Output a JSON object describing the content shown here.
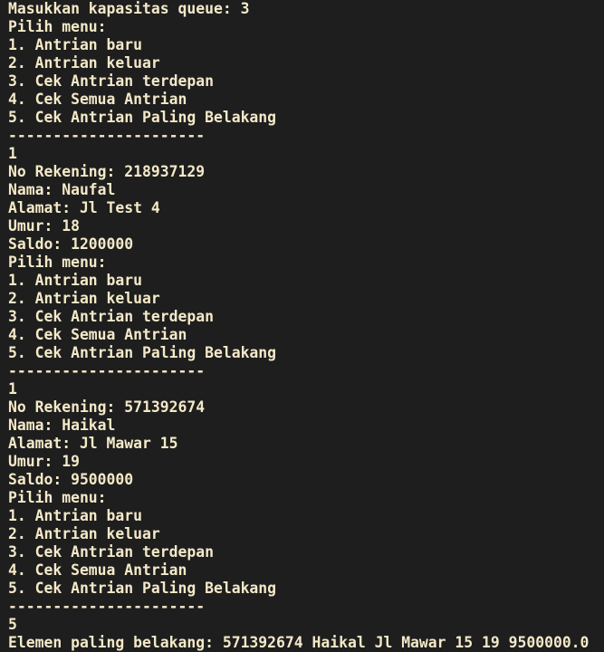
{
  "colors": {
    "background": "#1e1e1e",
    "text": "#f4e9c8"
  },
  "terminal": {
    "lines": [
      "Masukkan kapasitas queue: 3",
      "Pilih menu:",
      "1. Antrian baru",
      "2. Antrian keluar",
      "3. Cek Antrian terdepan",
      "4. Cek Semua Antrian",
      "5. Cek Antrian Paling Belakang",
      "----------------------",
      "1",
      "No Rekening: 218937129",
      "Nama: Naufal",
      "Alamat: Jl Test 4",
      "Umur: 18",
      "Saldo: 1200000",
      "Pilih menu:",
      "1. Antrian baru",
      "2. Antrian keluar",
      "3. Cek Antrian terdepan",
      "4. Cek Semua Antrian",
      "5. Cek Antrian Paling Belakang",
      "----------------------",
      "1",
      "No Rekening: 571392674",
      "Nama: Haikal",
      "Alamat: Jl Mawar 15",
      "Umur: 19",
      "Saldo: 9500000",
      "Pilih menu:",
      "1. Antrian baru",
      "2. Antrian keluar",
      "3. Cek Antrian terdepan",
      "4. Cek Semua Antrian",
      "5. Cek Antrian Paling Belakang",
      "----------------------",
      "5",
      "Elemen paling belakang: 571392674 Haikal Jl Mawar 15 19 9500000.0"
    ]
  }
}
